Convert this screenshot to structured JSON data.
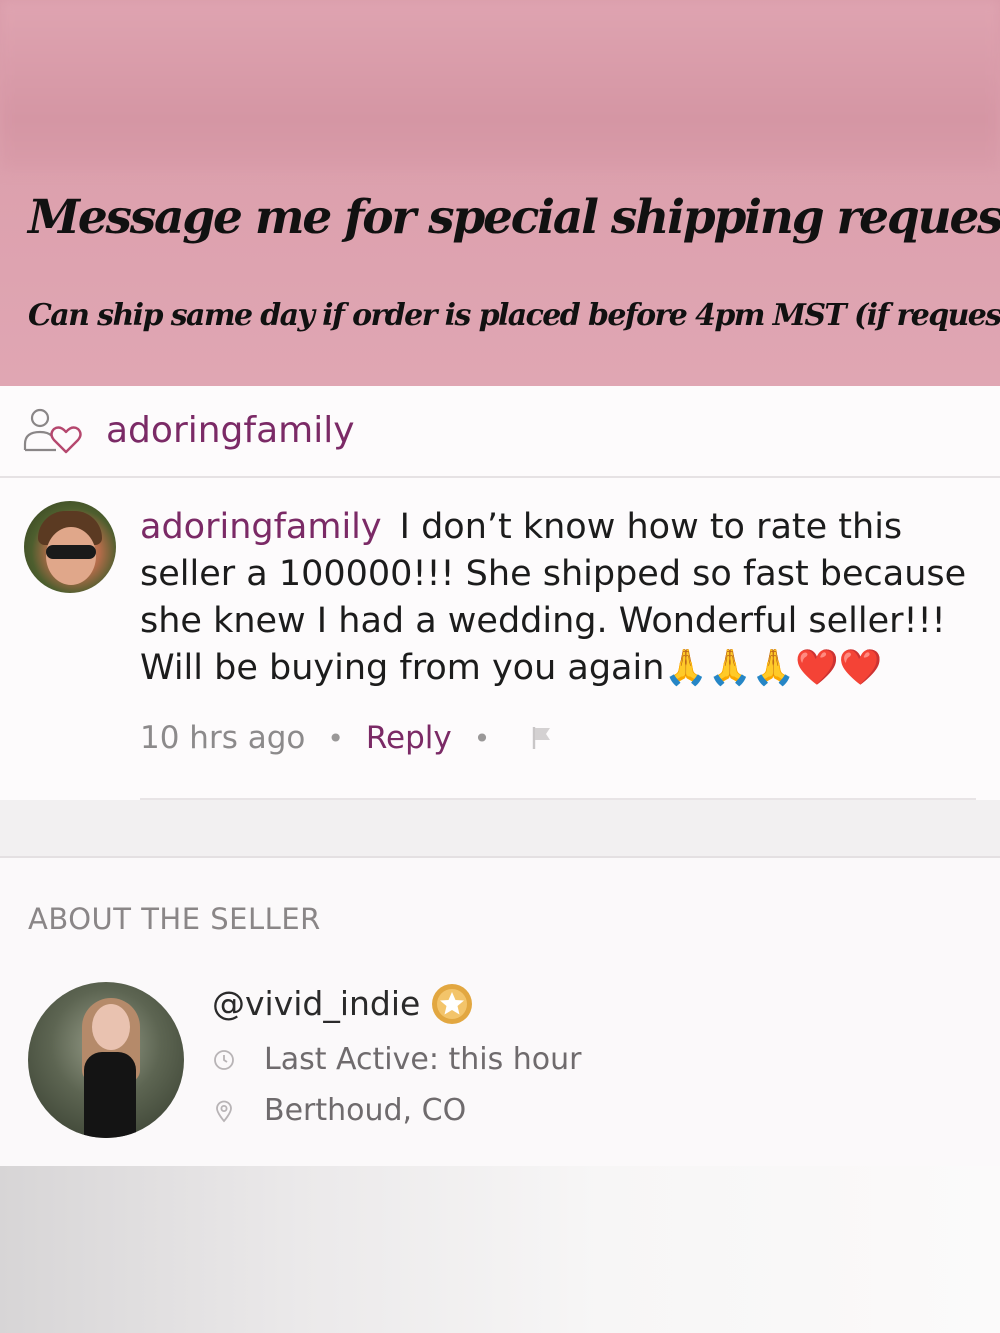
{
  "banner": {
    "title": "Message me for special shipping requests",
    "title_emoji": "❣️",
    "subtitle": "Can ship same day if order is placed before 4pm MST (if requested)"
  },
  "review_header": {
    "icon": "people-heart-icon",
    "username": "adoringfamily"
  },
  "comment": {
    "author": "adoringfamily",
    "text": "I don’t know how to rate this seller a 100000!!! She shipped so fast because she knew I had a wedding. Wonderful seller!!! Will be buying from you again🙏🙏🙏❤️❤️",
    "time": "10 hrs ago",
    "separator": "•",
    "reply_label": "Reply"
  },
  "about": {
    "section_title": "ABOUT THE SELLER",
    "handle": "@vivid_indie",
    "badge_icon": "star-badge-icon",
    "last_active": "Last Active: this hour",
    "location": "Berthoud, CO"
  },
  "colors": {
    "banner_pink": "#dca0ad",
    "accent_purple": "#7b2a66",
    "badge_gold": "#e2a740"
  }
}
